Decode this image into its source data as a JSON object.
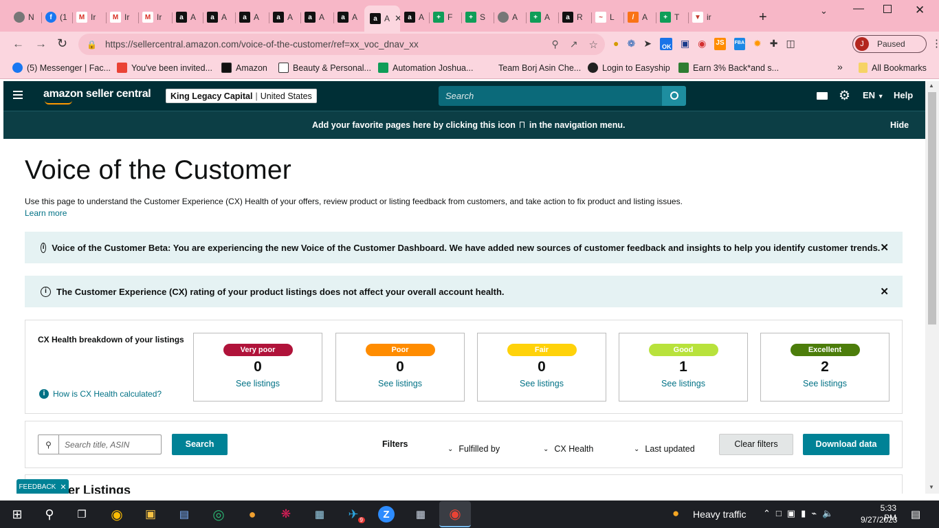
{
  "browser": {
    "tabs": [
      {
        "icon": "chrome-icon",
        "label": "N"
      },
      {
        "icon": "facebook-icon",
        "label": "(1"
      },
      {
        "icon": "gmail-icon",
        "label": "Ir"
      },
      {
        "icon": "gmail-icon",
        "label": "Ir"
      },
      {
        "icon": "gmail-icon",
        "label": "Ir"
      },
      {
        "icon": "amazon-icon",
        "label": "A"
      },
      {
        "icon": "amazon-icon",
        "label": "A"
      },
      {
        "icon": "amazon-icon",
        "label": "A"
      },
      {
        "icon": "amazon-icon",
        "label": "A"
      },
      {
        "icon": "amazon-icon",
        "label": "A"
      },
      {
        "icon": "amazon-icon",
        "label": "A"
      },
      {
        "icon": "amazon-icon",
        "label": "A"
      },
      {
        "icon": "amazon-icon",
        "label": "A"
      },
      {
        "icon": "sheets-icon",
        "label": "F"
      },
      {
        "icon": "sheets-icon",
        "label": "S"
      },
      {
        "icon": "chrome-icon",
        "label": "A"
      },
      {
        "icon": "sheets-icon",
        "label": "A"
      },
      {
        "icon": "amazon-icon",
        "label": "R"
      },
      {
        "icon": "chart-icon",
        "label": "L"
      },
      {
        "icon": "feather-icon",
        "label": "A"
      },
      {
        "icon": "sheets-icon",
        "label": "T"
      },
      {
        "icon": "filter-icon",
        "label": "ir"
      }
    ],
    "active_tab_index": 11,
    "url": "https://sellercentral.amazon.com/voice-of-the-customer/ref=xx_voc_dnav_xx",
    "profile_initial": "J",
    "profile_status": "Paused",
    "extension_badge": "OK",
    "bookmarks": [
      {
        "icon": "facebook-icon",
        "label": "(5) Messenger | Fac...",
        "color": "#1877f2"
      },
      {
        "icon": "gmail-icon",
        "label": "You've been invited...",
        "color": "#ea4335"
      },
      {
        "icon": "amazon-icon",
        "label": "Amazon",
        "color": "#111111"
      },
      {
        "icon": "amazon-icon",
        "label": "Beauty & Personal...",
        "color": "#ffffff"
      },
      {
        "icon": "sheets-icon",
        "label": "Automation Joshua...",
        "color": "#0f9d58"
      },
      {
        "icon": "logo-icon",
        "label": "Team Borj Asin Che...",
        "color": "#fbd6df"
      },
      {
        "icon": "easyship-icon",
        "label": "Login to Easyship",
        "color": "#222222"
      },
      {
        "icon": "cashback-icon",
        "label": "Earn 3% Back*and s...",
        "color": "#2e7d32"
      }
    ],
    "more_bookmarks": "»",
    "all_bookmarks": "All Bookmarks"
  },
  "header": {
    "logo": "amazon seller central",
    "store_name": "King Legacy Capital",
    "marketplace": "United States",
    "search_placeholder": "Search",
    "language": "EN",
    "help": "Help"
  },
  "favbar": {
    "text_before": "Add your favorite pages here by clicking this icon",
    "text_after": "in the navigation menu.",
    "hide": "Hide"
  },
  "main": {
    "title": "Voice of the Customer",
    "description": "Use this page to understand the Customer Experience (CX) Health of your offers, review product or listing feedback from customers, and take action to fix product and listing issues.",
    "learn_more": "Learn more",
    "banner1": "Voice of the Customer Beta: You are experiencing the new Voice of the Customer Dashboard. We have added new sources of customer feedback and insights to help you identify customer trends.",
    "banner2": "The Customer Experience (CX) rating of your product listings does not affect your overall account health.",
    "breakdown_title": "CX Health breakdown of your listings",
    "how_calculated": "How is CX Health calculated?",
    "health_cards": [
      {
        "label": "Very poor",
        "count": "0",
        "link": "See listings",
        "bg": "#b0133a",
        "fg": "#ffffff"
      },
      {
        "label": "Poor",
        "count": "0",
        "link": "See listings",
        "bg": "#ff8c00",
        "fg": "#ffffff"
      },
      {
        "label": "Fair",
        "count": "0",
        "link": "See listings",
        "bg": "#ffd20a",
        "fg": "#ffffff"
      },
      {
        "label": "Good",
        "count": "1",
        "link": "See listings",
        "bg": "#b8e23c",
        "fg": "#ffffff"
      },
      {
        "label": "Excellent",
        "count": "2",
        "link": "See listings",
        "bg": "#4c7d0b",
        "fg": "#ffffff"
      }
    ],
    "search_placeholder": "Search title, ASIN",
    "search_button": "Search",
    "filters_label": "Filters",
    "filter_fulfilled": "Fulfilled by",
    "filter_cx": "CX Health",
    "filter_updated": "Last updated",
    "clear_filters": "Clear filters",
    "download_data": "Download data",
    "listings_heading_partial": "er Listings",
    "feedback": "FEEDBACK"
  },
  "taskbar": {
    "weather": "Heavy traffic",
    "time": "5:33 PM",
    "date": "9/27/2023",
    "telegram_badge": "9"
  },
  "colors": {
    "header_bg": "#002f36",
    "favbar_bg": "#0c3e45",
    "accent_teal": "#007185",
    "banner_bg": "#e5f2f3",
    "chrome_pink": "#f7b7c7"
  }
}
